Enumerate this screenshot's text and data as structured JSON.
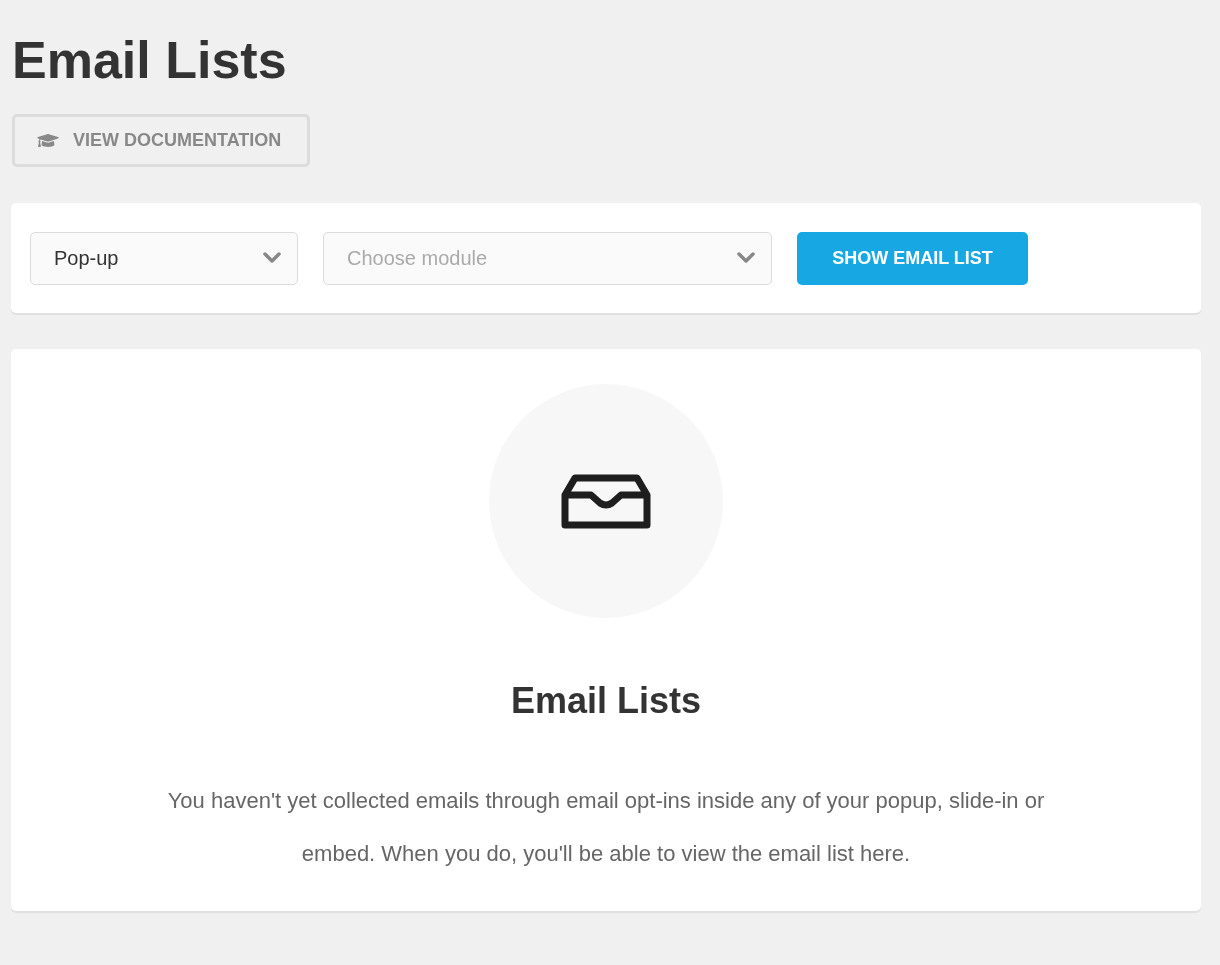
{
  "page": {
    "title": "Email Lists"
  },
  "documentation_button": {
    "label": "VIEW DOCUMENTATION"
  },
  "filters": {
    "module_type": {
      "value": "Pop-up"
    },
    "module": {
      "placeholder": "Choose module"
    },
    "show_button": {
      "label": "SHOW EMAIL LIST"
    }
  },
  "empty_state": {
    "title": "Email Lists",
    "message": "You haven't yet collected emails through email opt-ins inside any of your popup, slide-in or embed. When you do, you'll be able to view the email list here."
  }
}
